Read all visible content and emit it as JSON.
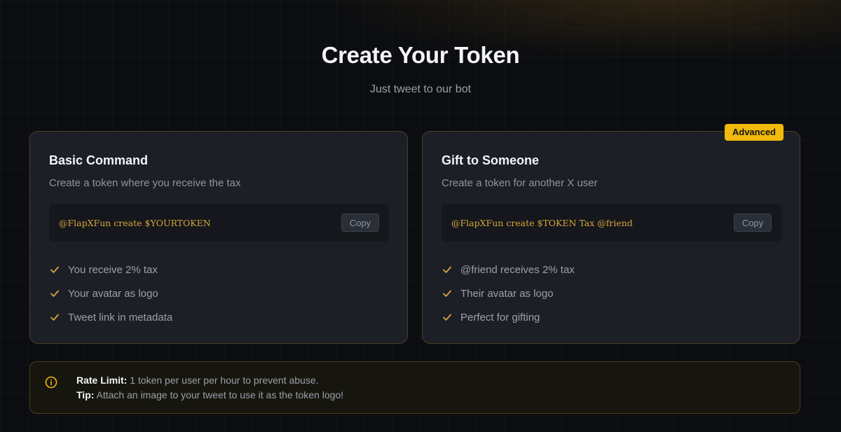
{
  "header": {
    "title": "Create Your Token",
    "subtitle": "Just tweet to our bot"
  },
  "cards": [
    {
      "title": "Basic Command",
      "description": "Create a token where you receive the tax",
      "command": "@FlapXFun create $YOURTOKEN",
      "copy_label": "Copy",
      "features": [
        "You receive 2% tax",
        "Your avatar as logo",
        "Tweet link in metadata"
      ]
    },
    {
      "badge": "Advanced",
      "title": "Gift to Someone",
      "description": "Create a token for another X user",
      "command": "@FlapXFun create $TOKEN Tax @friend",
      "copy_label": "Copy",
      "features": [
        "@friend receives 2% tax",
        "Their avatar as logo",
        "Perfect for gifting"
      ]
    }
  ],
  "notice": {
    "rate_limit_label": "Rate Limit:",
    "rate_limit_text": "1 token per user per hour to prevent abuse.",
    "tip_label": "Tip:",
    "tip_text": "Attach an image to your tweet to use it as the token logo!"
  },
  "icons": {
    "check": "check-icon",
    "info": "info-icon"
  },
  "colors": {
    "accent": "#f0b90b",
    "code": "#d4a73a",
    "background": "#0c0d10",
    "card": "#1c1f26"
  }
}
